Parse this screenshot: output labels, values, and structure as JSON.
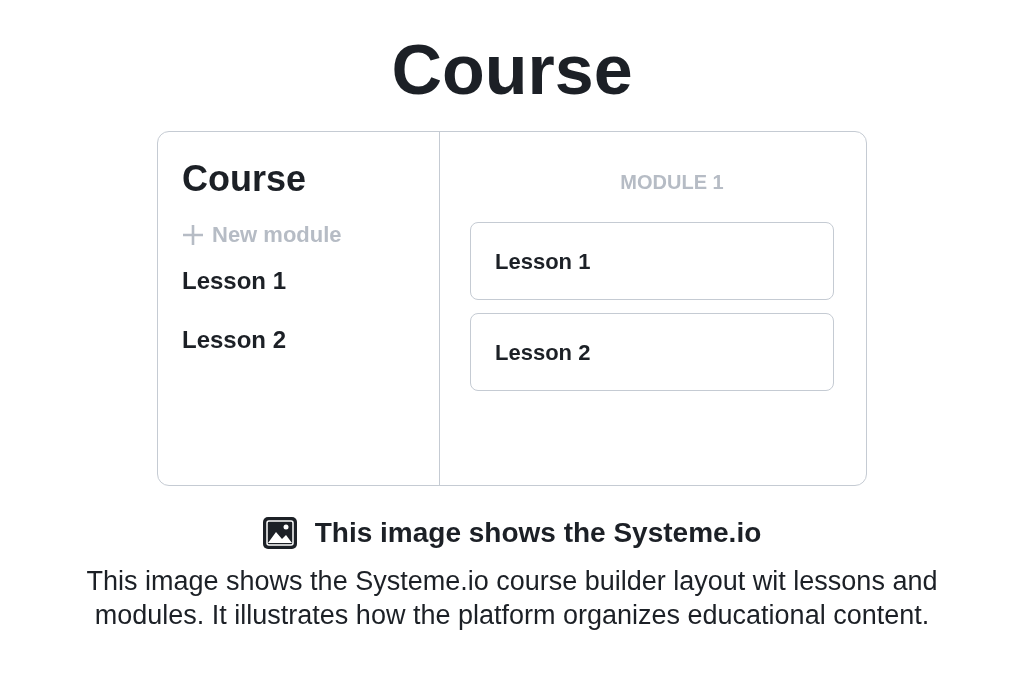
{
  "page_title": "Course",
  "course_builder": {
    "sidebar": {
      "title": "Course",
      "new_module_label": "New module",
      "lessons": [
        "Lesson 1",
        "Lesson 2"
      ]
    },
    "module": {
      "title": "MODULE 1",
      "lessons": [
        "Lesson 1",
        "Lesson 2"
      ]
    }
  },
  "caption": {
    "heading": "This image shows the Systeme.io",
    "text": "This image shows the Systeme.io course builder layout wit lessons and modules. It illustrates how the platform organizes educational content."
  }
}
